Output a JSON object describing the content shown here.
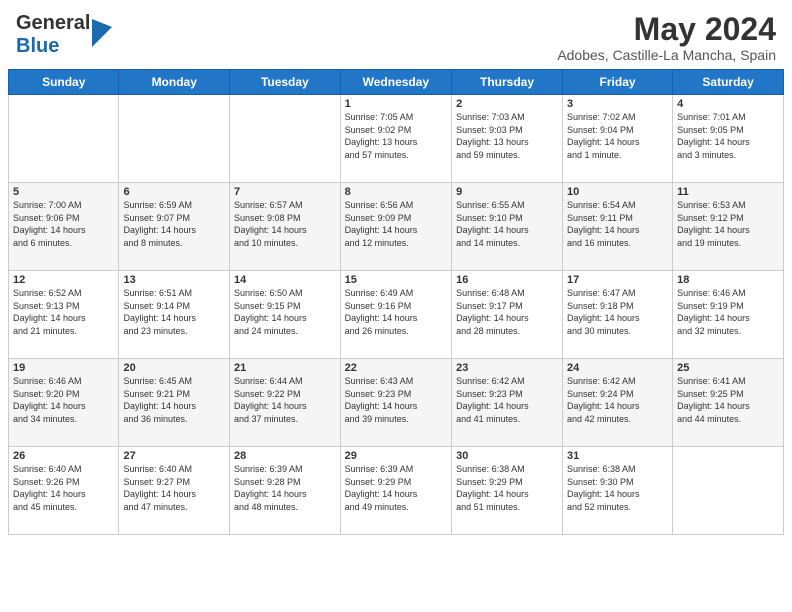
{
  "header": {
    "logo_general": "General",
    "logo_blue": "Blue",
    "main_title": "May 2024",
    "subtitle": "Adobes, Castille-La Mancha, Spain"
  },
  "calendar": {
    "days_of_week": [
      "Sunday",
      "Monday",
      "Tuesday",
      "Wednesday",
      "Thursday",
      "Friday",
      "Saturday"
    ],
    "weeks": [
      [
        {
          "day": "",
          "info": ""
        },
        {
          "day": "",
          "info": ""
        },
        {
          "day": "",
          "info": ""
        },
        {
          "day": "1",
          "info": "Sunrise: 7:05 AM\nSunset: 9:02 PM\nDaylight: 13 hours\nand 57 minutes."
        },
        {
          "day": "2",
          "info": "Sunrise: 7:03 AM\nSunset: 9:03 PM\nDaylight: 13 hours\nand 59 minutes."
        },
        {
          "day": "3",
          "info": "Sunrise: 7:02 AM\nSunset: 9:04 PM\nDaylight: 14 hours\nand 1 minute."
        },
        {
          "day": "4",
          "info": "Sunrise: 7:01 AM\nSunset: 9:05 PM\nDaylight: 14 hours\nand 3 minutes."
        }
      ],
      [
        {
          "day": "5",
          "info": "Sunrise: 7:00 AM\nSunset: 9:06 PM\nDaylight: 14 hours\nand 6 minutes."
        },
        {
          "day": "6",
          "info": "Sunrise: 6:59 AM\nSunset: 9:07 PM\nDaylight: 14 hours\nand 8 minutes."
        },
        {
          "day": "7",
          "info": "Sunrise: 6:57 AM\nSunset: 9:08 PM\nDaylight: 14 hours\nand 10 minutes."
        },
        {
          "day": "8",
          "info": "Sunrise: 6:56 AM\nSunset: 9:09 PM\nDaylight: 14 hours\nand 12 minutes."
        },
        {
          "day": "9",
          "info": "Sunrise: 6:55 AM\nSunset: 9:10 PM\nDaylight: 14 hours\nand 14 minutes."
        },
        {
          "day": "10",
          "info": "Sunrise: 6:54 AM\nSunset: 9:11 PM\nDaylight: 14 hours\nand 16 minutes."
        },
        {
          "day": "11",
          "info": "Sunrise: 6:53 AM\nSunset: 9:12 PM\nDaylight: 14 hours\nand 19 minutes."
        }
      ],
      [
        {
          "day": "12",
          "info": "Sunrise: 6:52 AM\nSunset: 9:13 PM\nDaylight: 14 hours\nand 21 minutes."
        },
        {
          "day": "13",
          "info": "Sunrise: 6:51 AM\nSunset: 9:14 PM\nDaylight: 14 hours\nand 23 minutes."
        },
        {
          "day": "14",
          "info": "Sunrise: 6:50 AM\nSunset: 9:15 PM\nDaylight: 14 hours\nand 24 minutes."
        },
        {
          "day": "15",
          "info": "Sunrise: 6:49 AM\nSunset: 9:16 PM\nDaylight: 14 hours\nand 26 minutes."
        },
        {
          "day": "16",
          "info": "Sunrise: 6:48 AM\nSunset: 9:17 PM\nDaylight: 14 hours\nand 28 minutes."
        },
        {
          "day": "17",
          "info": "Sunrise: 6:47 AM\nSunset: 9:18 PM\nDaylight: 14 hours\nand 30 minutes."
        },
        {
          "day": "18",
          "info": "Sunrise: 6:46 AM\nSunset: 9:19 PM\nDaylight: 14 hours\nand 32 minutes."
        }
      ],
      [
        {
          "day": "19",
          "info": "Sunrise: 6:46 AM\nSunset: 9:20 PM\nDaylight: 14 hours\nand 34 minutes."
        },
        {
          "day": "20",
          "info": "Sunrise: 6:45 AM\nSunset: 9:21 PM\nDaylight: 14 hours\nand 36 minutes."
        },
        {
          "day": "21",
          "info": "Sunrise: 6:44 AM\nSunset: 9:22 PM\nDaylight: 14 hours\nand 37 minutes."
        },
        {
          "day": "22",
          "info": "Sunrise: 6:43 AM\nSunset: 9:23 PM\nDaylight: 14 hours\nand 39 minutes."
        },
        {
          "day": "23",
          "info": "Sunrise: 6:42 AM\nSunset: 9:23 PM\nDaylight: 14 hours\nand 41 minutes."
        },
        {
          "day": "24",
          "info": "Sunrise: 6:42 AM\nSunset: 9:24 PM\nDaylight: 14 hours\nand 42 minutes."
        },
        {
          "day": "25",
          "info": "Sunrise: 6:41 AM\nSunset: 9:25 PM\nDaylight: 14 hours\nand 44 minutes."
        }
      ],
      [
        {
          "day": "26",
          "info": "Sunrise: 6:40 AM\nSunset: 9:26 PM\nDaylight: 14 hours\nand 45 minutes."
        },
        {
          "day": "27",
          "info": "Sunrise: 6:40 AM\nSunset: 9:27 PM\nDaylight: 14 hours\nand 47 minutes."
        },
        {
          "day": "28",
          "info": "Sunrise: 6:39 AM\nSunset: 9:28 PM\nDaylight: 14 hours\nand 48 minutes."
        },
        {
          "day": "29",
          "info": "Sunrise: 6:39 AM\nSunset: 9:29 PM\nDaylight: 14 hours\nand 49 minutes."
        },
        {
          "day": "30",
          "info": "Sunrise: 6:38 AM\nSunset: 9:29 PM\nDaylight: 14 hours\nand 51 minutes."
        },
        {
          "day": "31",
          "info": "Sunrise: 6:38 AM\nSunset: 9:30 PM\nDaylight: 14 hours\nand 52 minutes."
        },
        {
          "day": "",
          "info": ""
        }
      ]
    ]
  }
}
